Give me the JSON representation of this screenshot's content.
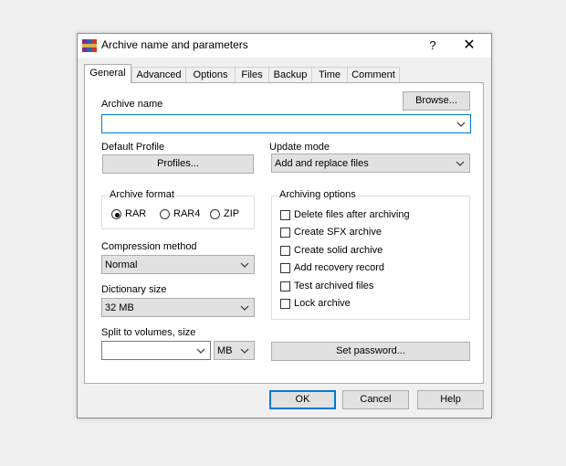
{
  "window": {
    "title": "Archive name and parameters",
    "help_glyph": "?",
    "close_glyph": "✕"
  },
  "tabs": [
    {
      "label": "General",
      "active": true
    },
    {
      "label": "Advanced"
    },
    {
      "label": "Options"
    },
    {
      "label": "Files"
    },
    {
      "label": "Backup"
    },
    {
      "label": "Time"
    },
    {
      "label": "Comment"
    }
  ],
  "general": {
    "archive_name_label": "Archive name",
    "browse_label": "Browse...",
    "archive_name_value": "",
    "default_profile_label": "Default Profile",
    "profiles_label": "Profiles...",
    "update_mode_label": "Update mode",
    "update_mode_value": "Add and replace files",
    "archive_format_label": "Archive format",
    "formats": [
      {
        "label": "RAR",
        "selected": true
      },
      {
        "label": "RAR4",
        "selected": false
      },
      {
        "label": "ZIP",
        "selected": false
      }
    ],
    "compression_method_label": "Compression method",
    "compression_method_value": "Normal",
    "dictionary_size_label": "Dictionary size",
    "dictionary_size_value": "32 MB",
    "split_label": "Split to volumes, size",
    "split_value": "",
    "split_unit": "MB",
    "archiving_options_label": "Archiving options",
    "options": [
      {
        "label": "Delete files after archiving",
        "checked": false
      },
      {
        "label": "Create SFX archive",
        "checked": false
      },
      {
        "label": "Create solid archive",
        "checked": false
      },
      {
        "label": "Add recovery record",
        "checked": false
      },
      {
        "label": "Test archived files",
        "checked": false
      },
      {
        "label": "Lock archive",
        "checked": false
      }
    ],
    "set_password_label": "Set password..."
  },
  "footer": {
    "ok_label": "OK",
    "cancel_label": "Cancel",
    "help_label": "Help"
  },
  "colors": {
    "accent": "#0078d7",
    "button_bg": "#e1e1e1"
  },
  "icons": {
    "app": "winrar-books-icon",
    "dropdown": "chevron-down-icon"
  }
}
